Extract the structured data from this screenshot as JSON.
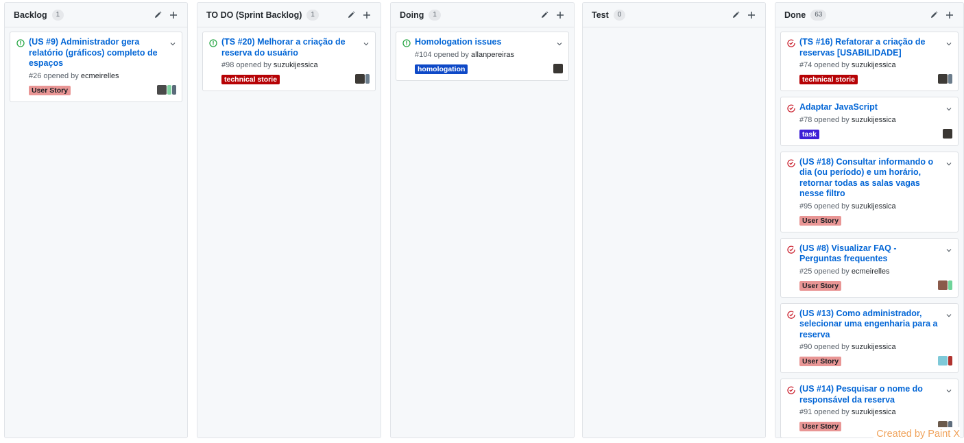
{
  "board": {
    "columns": [
      {
        "title": "Backlog",
        "count": "1",
        "cards": [
          {
            "status": "open",
            "title": "(US #9) Administrador gera relatório (gráficos) completo de espaços",
            "number": "#26",
            "opened_text": "opened by",
            "author": "ecmeirelles",
            "labels": [
              {
                "text": "User Story",
                "bg": "#e99695",
                "fg": "#1b1f23"
              }
            ],
            "avatars": [
              "#4a4a4a",
              "#7fd3a1",
              "#5b6b7a"
            ]
          }
        ]
      },
      {
        "title": "TO DO (Sprint Backlog)",
        "count": "1",
        "cards": [
          {
            "status": "open",
            "title": "(TS #20) Melhorar a criação de reserva do usuário",
            "number": "#98",
            "opened_text": "opened by",
            "author": "suzukijessica",
            "labels": [
              {
                "text": "technical storie",
                "bg": "#b60205",
                "fg": "#ffffff"
              }
            ],
            "avatars": [
              "#3d3a36",
              "#6c7d8c"
            ]
          }
        ]
      },
      {
        "title": "Doing",
        "count": "1",
        "cards": [
          {
            "status": "open",
            "title": "Homologation issues",
            "number": "#104",
            "opened_text": "opened by",
            "author": "allanpereiras",
            "labels": [
              {
                "text": "homologation",
                "bg": "#0e49c7",
                "fg": "#ffffff"
              }
            ],
            "avatars": [
              "#3a3733"
            ]
          }
        ]
      },
      {
        "title": "Test",
        "count": "0",
        "cards": []
      },
      {
        "title": "Done",
        "count": "63",
        "cards": [
          {
            "status": "closed",
            "title": "(TS #16) Refatorar a criação de reservas [USABILIDADE]",
            "number": "#74",
            "opened_text": "opened by",
            "author": "suzukijessica",
            "labels": [
              {
                "text": "technical storie",
                "bg": "#b60205",
                "fg": "#ffffff"
              }
            ],
            "avatars": [
              "#3d3a36",
              "#6c7d8c"
            ]
          },
          {
            "status": "closed",
            "title": "Adaptar JavaScript",
            "number": "#78",
            "opened_text": "opened by",
            "author": "suzukijessica",
            "labels": [
              {
                "text": "task",
                "bg": "#3d1fd6",
                "fg": "#ffffff"
              }
            ],
            "avatars": [
              "#3a3733"
            ]
          },
          {
            "status": "closed",
            "title": "(US #18) Consultar informando o dia (ou período) e um horário, retornar todas as salas vagas nesse filtro",
            "number": "#95",
            "opened_text": "opened by",
            "author": "suzukijessica",
            "labels": [
              {
                "text": "User Story",
                "bg": "#e99695",
                "fg": "#1b1f23"
              }
            ],
            "avatars": []
          },
          {
            "status": "closed",
            "title": "(US #8) Visualizar FAQ - Perguntas frequentes",
            "number": "#25",
            "opened_text": "opened by",
            "author": "ecmeirelles",
            "labels": [
              {
                "text": "User Story",
                "bg": "#e99695",
                "fg": "#1b1f23"
              }
            ],
            "avatars": [
              "#8a5a4a",
              "#6fd49a"
            ]
          },
          {
            "status": "closed",
            "title": "(US #13) Como administrador, selecionar uma engenharia para a reserva",
            "number": "#90",
            "opened_text": "opened by",
            "author": "suzukijessica",
            "labels": [
              {
                "text": "User Story",
                "bg": "#e99695",
                "fg": "#1b1f23"
              }
            ],
            "avatars": [
              "#7ec9d8",
              "#b0332f"
            ]
          },
          {
            "status": "closed",
            "title": "(US #14) Pesquisar o nome do responsável da reserva",
            "number": "#91",
            "opened_text": "opened by",
            "author": "suzukijessica",
            "labels": [
              {
                "text": "User Story",
                "bg": "#e99695",
                "fg": "#1b1f23"
              }
            ],
            "avatars": [
              "#6b5a4c",
              "#5f6e7d"
            ]
          }
        ]
      }
    ]
  },
  "watermark": "Created by Paint X",
  "colors": {
    "open_icon": "#28a745",
    "closed_icon": "#cb2431",
    "link": "#0366d6"
  }
}
